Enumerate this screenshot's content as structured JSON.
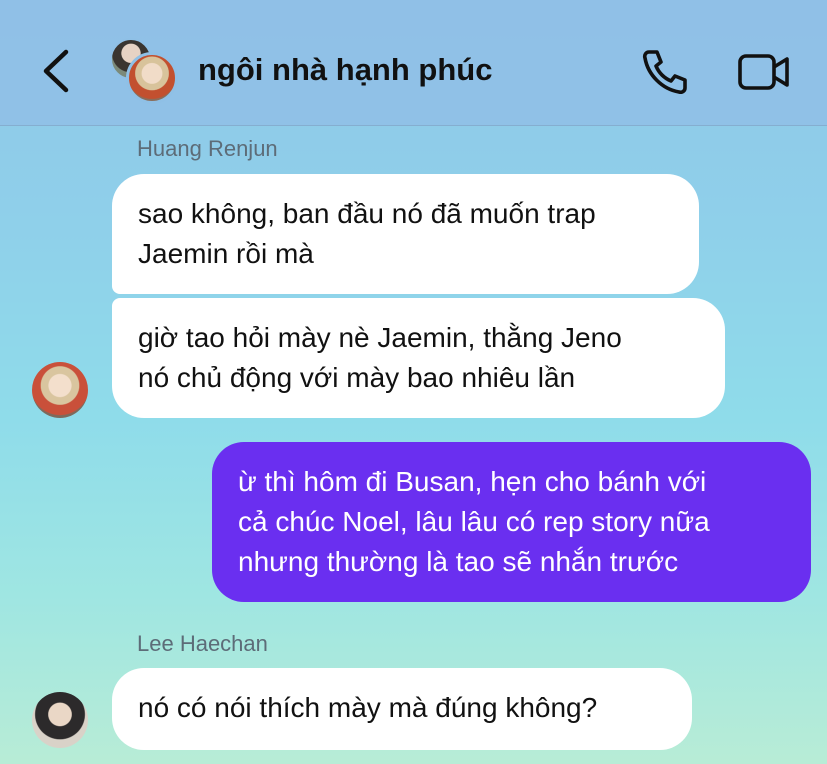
{
  "header": {
    "title": "ngôi nhà hạnh phúc",
    "back_icon": "chevron-left-icon",
    "call_icon": "phone-icon",
    "video_icon": "video-camera-icon"
  },
  "messages": [
    {
      "sender": "Huang Renjun",
      "direction": "incoming",
      "lines": [
        "sao không, ban đầu nó đã muốn trap",
        "Jaemin rồi mà"
      ]
    },
    {
      "direction": "incoming",
      "lines": [
        "giờ tao hỏi mày nè Jaemin, thằng Jeno",
        "nó chủ động với mày bao nhiêu lần"
      ]
    },
    {
      "direction": "outgoing",
      "lines": [
        "ừ thì hôm đi Busan, hẹn cho bánh với",
        "cả chúc Noel, lâu lâu có rep story nữa",
        "nhưng thường là tao sẽ nhắn trước"
      ]
    },
    {
      "sender": "Lee Haechan",
      "direction": "incoming",
      "lines": [
        "nó có nói thích mày mà đúng không?"
      ]
    }
  ],
  "colors": {
    "header_bg": "#8fc0e6",
    "outgoing_bubble": "#6a2ff0",
    "incoming_bubble": "#ffffff"
  }
}
